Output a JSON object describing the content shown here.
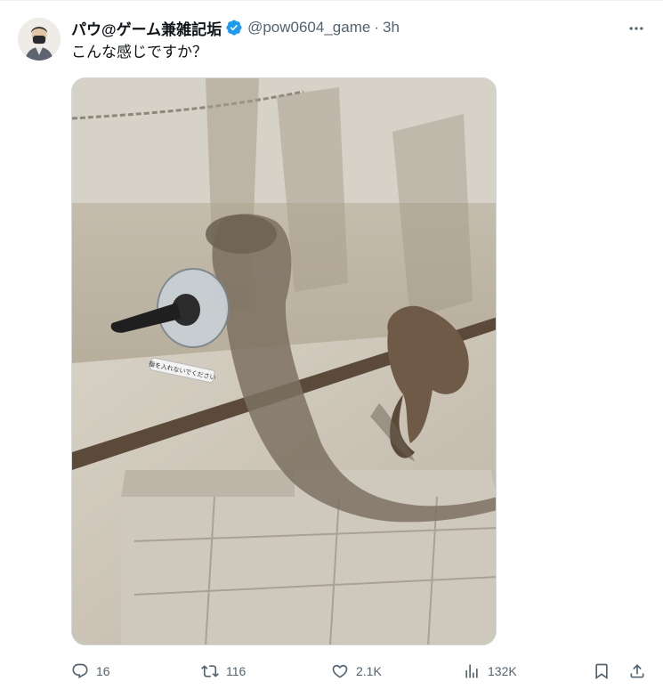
{
  "tweet": {
    "display_name": "パウ@ゲーム兼雑記垢",
    "handle": "@pow0604_game",
    "separator": "·",
    "time": "3h",
    "text": "こんな感じですか？",
    "media": {
      "sign_text": "指を入れないでください"
    }
  },
  "actions": {
    "replies": "16",
    "retweets": "116",
    "likes": "2.1K",
    "views": "132K"
  },
  "icons": {
    "verified": "verified-badge-icon",
    "more": "more-options-icon",
    "reply": "reply-icon",
    "retweet": "retweet-icon",
    "like": "heart-icon",
    "views": "views-chart-icon",
    "bookmark": "bookmark-icon",
    "share": "share-icon"
  },
  "colors": {
    "text_primary": "#0f1419",
    "text_secondary": "#536471",
    "verified_blue": "#1d9bf0",
    "border": "#cfd9de"
  }
}
